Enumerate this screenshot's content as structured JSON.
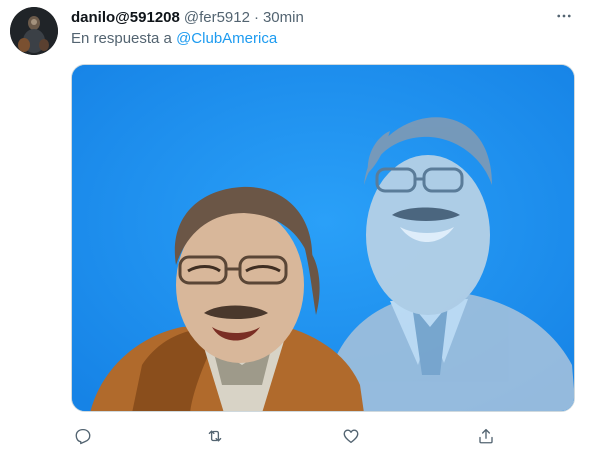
{
  "tweet": {
    "display_name": "danilo@591208",
    "handle": "@fer5912",
    "separator": "·",
    "time": "30min",
    "reply_prefix": "En respuesta a",
    "reply_mention": "@ClubAmerica"
  },
  "icons": {
    "more": "more-horizontal-icon",
    "reply": "reply-icon",
    "retweet": "retweet-icon",
    "like": "heart-icon",
    "share": "share-icon"
  },
  "colors": {
    "accent": "#1d9bf0",
    "secondary_text": "#536471",
    "media_background": "#1e8ff0"
  }
}
